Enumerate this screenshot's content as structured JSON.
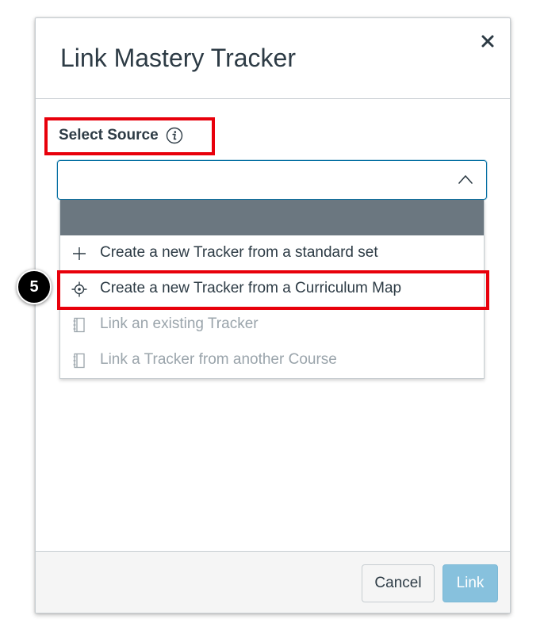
{
  "modal": {
    "title": "Link Mastery Tracker"
  },
  "select_source": {
    "label": "Select Source",
    "value": ""
  },
  "dropdown": {
    "options": [
      {
        "label": "Create a new Tracker from a standard set",
        "icon": "plus-icon",
        "enabled": true
      },
      {
        "label": "Create a new Tracker from a Curriculum Map",
        "icon": "target-icon",
        "enabled": true
      },
      {
        "label": "Link an existing Tracker",
        "icon": "notebook-icon",
        "enabled": false
      },
      {
        "label": "Link a Tracker from another Course",
        "icon": "notebook-icon",
        "enabled": false
      }
    ]
  },
  "annotation": {
    "step": "5",
    "color": "#e8000b"
  },
  "footer": {
    "cancel_label": "Cancel",
    "link_label": "Link"
  },
  "colors": {
    "text": "#2d3b45",
    "disabled_text": "#9aa4ab",
    "focus_border": "#0770a3",
    "link_button": "#87c1dd",
    "highlight": "#6b7780"
  }
}
